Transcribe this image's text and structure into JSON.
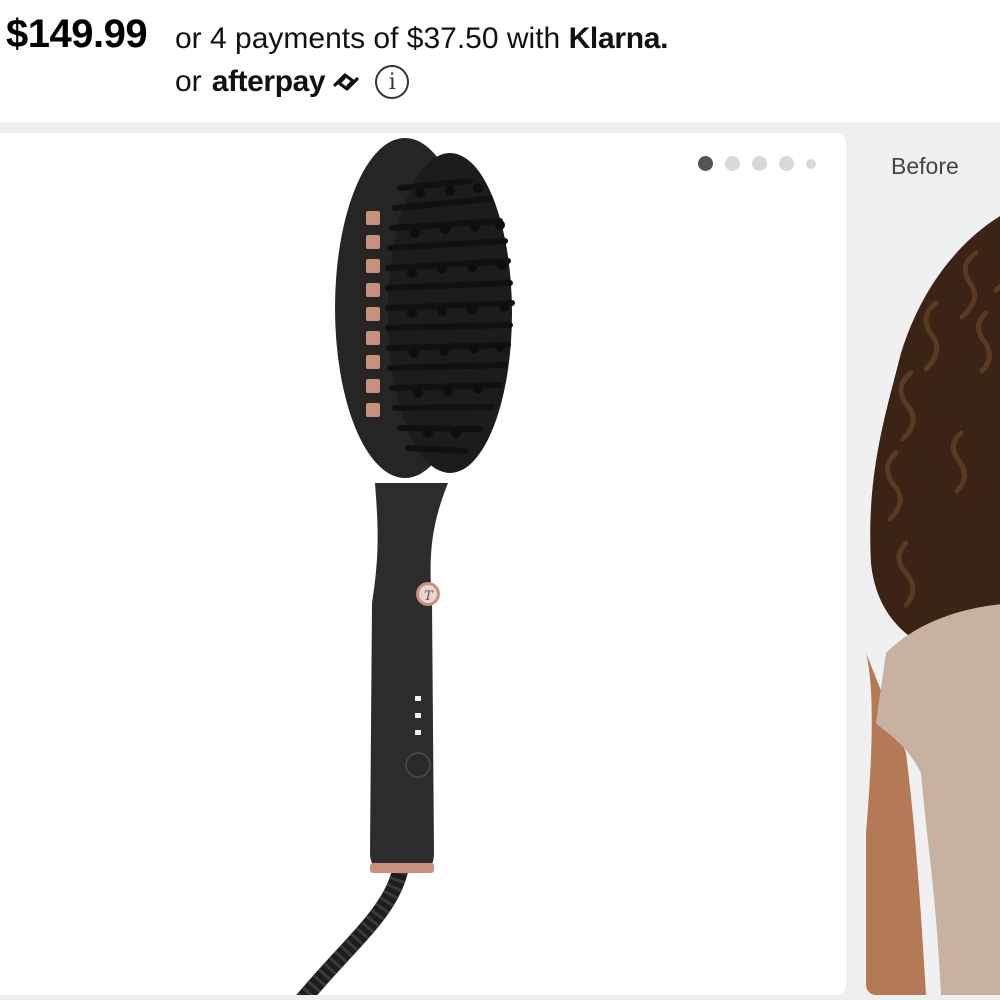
{
  "price": {
    "amount": "$149.99",
    "installment_text": "or 4 payments of $37.50 with ",
    "klarna_brand": "Klarna.",
    "afterpay_prefix": "or",
    "afterpay_brand": "afterpay",
    "info_glyph": "i"
  },
  "gallery": {
    "slide_count": 5,
    "active_slide": 1,
    "main_image": "hair-straightening-brush-image",
    "side_label": "Before"
  },
  "colors": {
    "brush_body": "#2b2b2b",
    "accent_rose_gold": "#c9907e",
    "active_dot": "#555555"
  }
}
